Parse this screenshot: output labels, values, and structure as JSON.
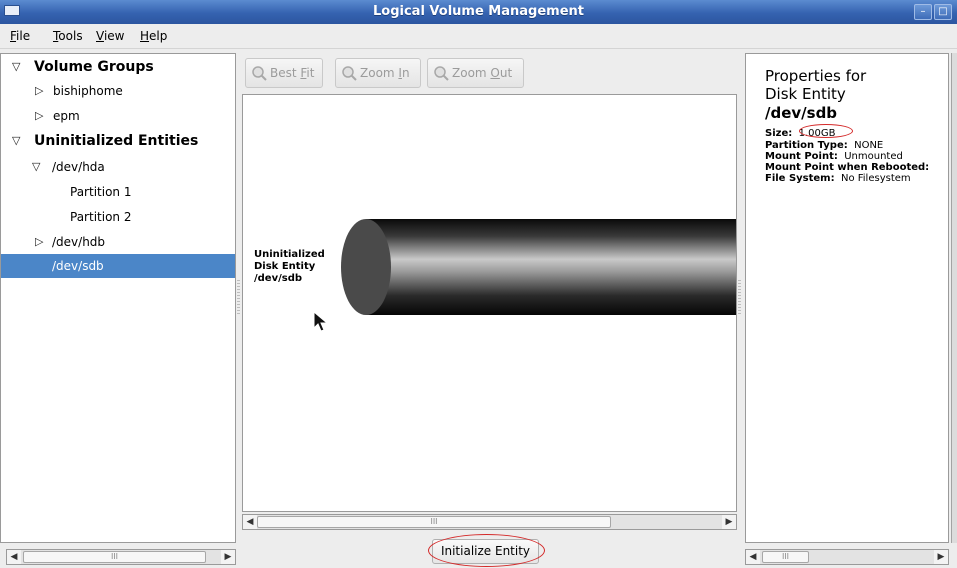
{
  "window": {
    "title": "Logical Volume Management",
    "minimize_glyph": "–",
    "maximize_glyph": "□"
  },
  "menu": [
    {
      "mnemonic": "F",
      "rest": "ile"
    },
    {
      "mnemonic": "T",
      "rest": "ools"
    },
    {
      "mnemonic": "V",
      "rest": "iew"
    },
    {
      "mnemonic": "H",
      "rest": "elp"
    }
  ],
  "tree": {
    "items": [
      {
        "label": "Volume Groups",
        "arrow": "▽"
      },
      {
        "label": "bishiphome",
        "arrow": "▷"
      },
      {
        "label": "epm",
        "arrow": "▷"
      },
      {
        "label": "Uninitialized Entities",
        "arrow": "▽"
      },
      {
        "label": "/dev/hda",
        "arrow": "▽"
      },
      {
        "label": "Partition 1",
        "arrow": ""
      },
      {
        "label": "Partition 2",
        "arrow": ""
      },
      {
        "label": "/dev/hdb",
        "arrow": "▷"
      },
      {
        "label": "/dev/sdb",
        "arrow": ""
      }
    ],
    "selected_label": "/dev/sdb"
  },
  "toolbar": {
    "best_fit": {
      "prefix": "Best ",
      "mnemonic": "F",
      "suffix": "it"
    },
    "zoom_in": {
      "prefix": "Zoom ",
      "mnemonic": "I",
      "suffix": "n"
    },
    "zoom_out": {
      "prefix": "Zoom ",
      "mnemonic": "O",
      "suffix": "ut"
    }
  },
  "canvas": {
    "label_line1": "Uninitialized",
    "label_line2": "Disk Entity",
    "label_line3": "/dev/sdb"
  },
  "scrollbar": {
    "thumb_grip": "III",
    "left_arrow": "◀",
    "right_arrow": "▶"
  },
  "actions": {
    "initialize_entity": "Initialize Entity"
  },
  "properties": {
    "heading_line1": "Properties for",
    "heading_line2": "Disk Entity",
    "device": "/dev/sdb",
    "fields": [
      {
        "label": "Size:",
        "value": "1.00GB"
      },
      {
        "label": "Partition Type:",
        "value": "NONE"
      },
      {
        "label": "Mount Point:",
        "value": "Unmounted"
      },
      {
        "label": "Mount Point when Rebooted:",
        "value": ""
      },
      {
        "label": "File System:",
        "value": "No Filesystem"
      }
    ]
  },
  "colors": {
    "selection": "#4b86c8",
    "titlebar": "#3563b0",
    "annotation": "#d42a2a"
  }
}
